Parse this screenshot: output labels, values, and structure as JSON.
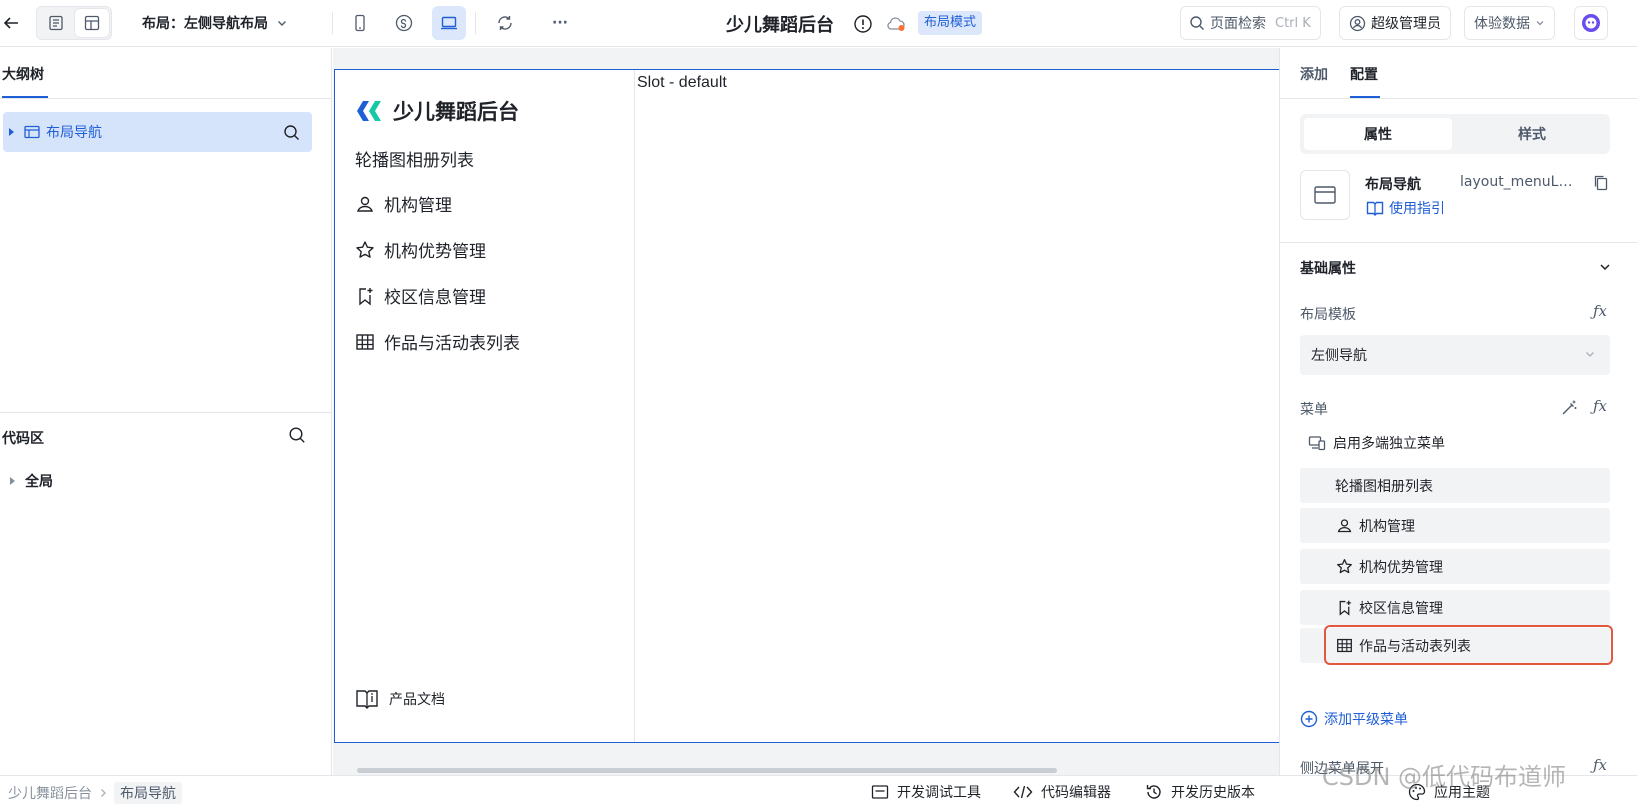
{
  "topbar": {
    "layout_prefix": "布局：",
    "layout_value": "左侧导航布局",
    "app_title": "少儿舞蹈后台",
    "mode_badge": "布局模式",
    "search_placeholder": "页面检索",
    "search_shortcut": "Ctrl K",
    "user_label": "超级管理员",
    "data_label": "体验数据",
    "more_label": "···"
  },
  "left_panel": {
    "outline_tab": "大纲树",
    "tree_item": "布局导航",
    "code_title": "代码区",
    "code_item": "全局"
  },
  "canvas": {
    "brand": "少儿舞蹈后台",
    "first_menu": "轮播图相册列表",
    "menu_items": [
      "机构管理",
      "机构优势管理",
      "校区信息管理",
      "作品与活动表列表"
    ],
    "doc_link": "产品文档",
    "slot_label": "Slot - default"
  },
  "right_panel": {
    "tabs": [
      "添加",
      "配置"
    ],
    "segment": [
      "属性",
      "样式"
    ],
    "component_name": "布局导航",
    "component_id": "layout_menuLay...",
    "guide_link": "使用指引",
    "section_title": "基础属性",
    "template_label": "布局模板",
    "template_value": "左侧导航",
    "menu_label": "菜单",
    "multi_menu": "启用多端独立菜单",
    "menu_rows": [
      "轮播图相册列表",
      "机构管理",
      "机构优势管理",
      "校区信息管理",
      "作品与活动表列表"
    ],
    "add_menu": "添加平级菜单",
    "side_open": "侧边菜单展开",
    "fx": "ƒx"
  },
  "statusbar": {
    "crumbs": [
      "少儿舞蹈后台",
      "布局导航"
    ],
    "debug_tool": "开发调试工具",
    "code_editor": "代码编辑器",
    "history": "开发历史版本",
    "theme": "应用主题"
  },
  "watermark": "CSDN @低代码布道师",
  "colors": {
    "accent": "#1f5fd6",
    "highlight_border": "#e2583e",
    "selected_row": "#d6e4fb"
  }
}
